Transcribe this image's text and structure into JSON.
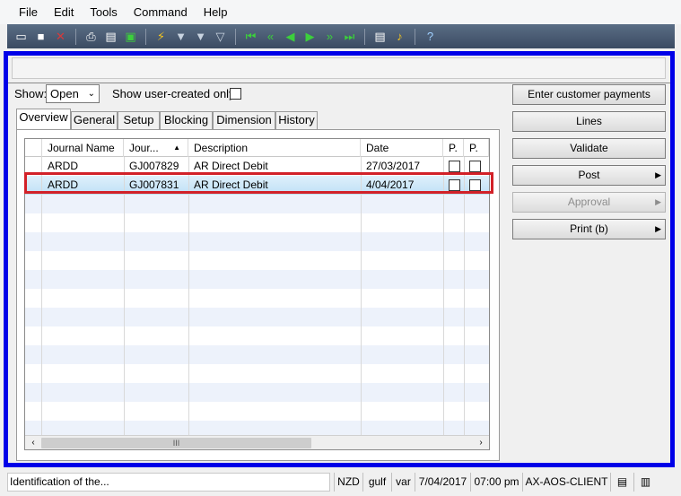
{
  "menu": {
    "items": [
      "File",
      "Edit",
      "Tools",
      "Command",
      "Help"
    ]
  },
  "toolbar": {
    "icons": [
      "new-record-icon",
      "save-icon",
      "delete-icon",
      "print-icon",
      "print-preview-icon",
      "export-to-excel-icon",
      "attachments-icon",
      "filter-by-selection-icon",
      "advanced-filter-icon",
      "remove-filter-icon",
      "first-record-icon",
      "previous-page-icon",
      "previous-record-icon",
      "next-record-icon",
      "next-page-icon",
      "last-record-icon",
      "document-handling-icon",
      "alerts-icon",
      "help-icon"
    ]
  },
  "filter": {
    "show_label": "Show:",
    "show_value": "Open",
    "user_created_label": "Show user-created only:",
    "user_created_checked": false
  },
  "tabs": [
    {
      "label": "Overview",
      "active": true
    },
    {
      "label": "General",
      "active": false
    },
    {
      "label": "Setup",
      "active": false
    },
    {
      "label": "Blocking",
      "active": false
    },
    {
      "label": "Dimension",
      "active": false
    },
    {
      "label": "History",
      "active": false
    }
  ],
  "grid": {
    "columns": [
      "Journal Name",
      "Jour...",
      "Description",
      "Date",
      "P.",
      "P."
    ],
    "sort_column": "Jour...",
    "rows": [
      {
        "journal_name": "ARDD",
        "journal": "GJ007829",
        "description": "AR Direct Debit",
        "date": "27/03/2017",
        "posted": false,
        "p2": false,
        "selected": false
      },
      {
        "journal_name": "ARDD",
        "journal": "GJ007831",
        "description": "AR Direct Debit",
        "date": "4/04/2017",
        "posted": false,
        "p2": false,
        "selected": true
      }
    ],
    "hscroll_thumb": "III"
  },
  "actions": {
    "enter_payments": "Enter customer payments",
    "lines": "Lines",
    "validate": "Validate",
    "post": "Post",
    "approval": "Approval",
    "print": "Print (b)"
  },
  "status": {
    "help_text": "Identification of the...",
    "currency": "NZD",
    "company": "gulf",
    "layer": "var",
    "date": "7/04/2017",
    "time": "07:00 pm",
    "server": "AX-AOS-CLIENT"
  },
  "colors": {
    "frame_border": "#0000e8",
    "highlight_box": "#d22128",
    "selected_row": "#bfe0f6"
  }
}
